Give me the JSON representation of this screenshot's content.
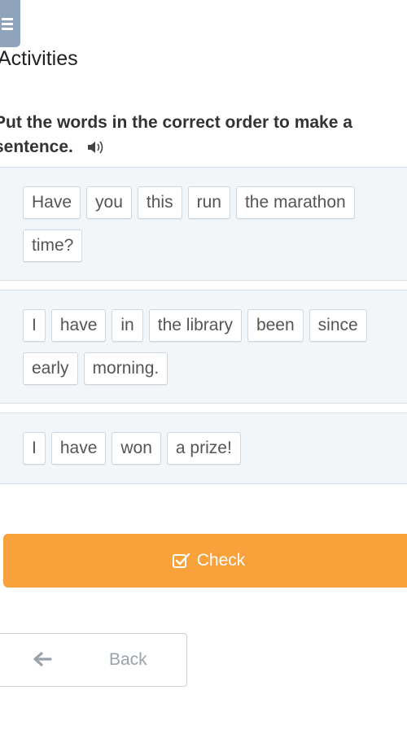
{
  "header": {
    "title": "Activities",
    "menu_icon": "hamburger-menu-icon"
  },
  "instruction": {
    "line1": "Put the words in the correct order to make a",
    "line2": "sentence.",
    "audio_icon": "speaker-icon"
  },
  "exercises": [
    {
      "row1": [
        "Have",
        "you",
        "this",
        "run",
        "the marathon"
      ],
      "row2": [
        "time?"
      ]
    },
    {
      "row1": [
        "I",
        "have",
        "in",
        "the library",
        "been",
        "since"
      ],
      "row2": [
        "early",
        "morning."
      ]
    },
    {
      "row1": [
        "I",
        "have",
        "won",
        "a prize!"
      ]
    }
  ],
  "check_button": {
    "label": "Check",
    "icon": "checkbox-icon",
    "color": "#f9a13a"
  },
  "back_button": {
    "label": "Back",
    "icon": "arrow-left-icon"
  }
}
